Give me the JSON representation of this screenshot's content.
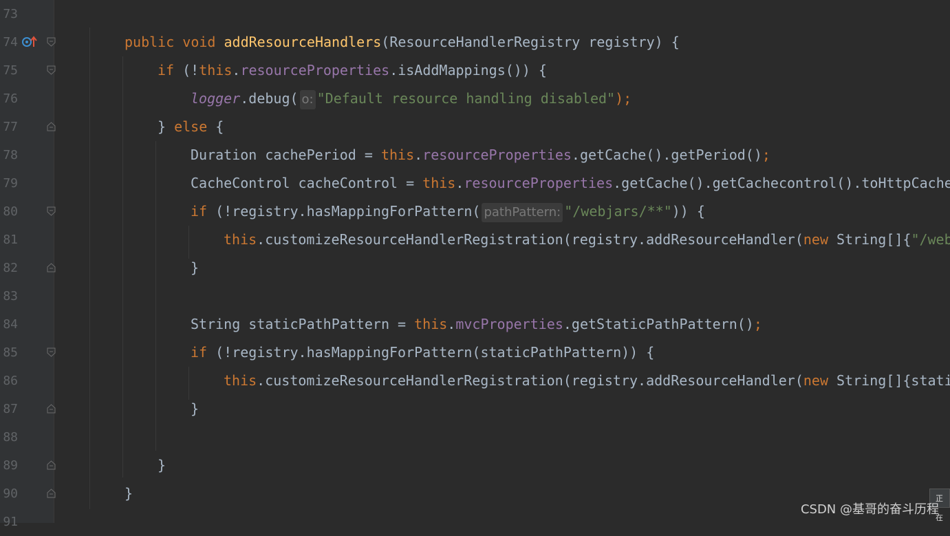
{
  "editor": {
    "lines": [
      {
        "num": "73"
      },
      {
        "num": "74"
      },
      {
        "num": "75"
      },
      {
        "num": "76"
      },
      {
        "num": "77"
      },
      {
        "num": "78"
      },
      {
        "num": "79"
      },
      {
        "num": "80"
      },
      {
        "num": "81"
      },
      {
        "num": "82"
      },
      {
        "num": "83"
      },
      {
        "num": "84"
      },
      {
        "num": "85"
      },
      {
        "num": "86"
      },
      {
        "num": "87"
      },
      {
        "num": "88"
      },
      {
        "num": "89"
      },
      {
        "num": "90"
      },
      {
        "num": "91"
      }
    ],
    "code": {
      "l74": {
        "public": "public",
        "void": "void",
        "method": "addResourceHandlers",
        "params": "(ResourceHandlerRegistry registry) {"
      },
      "l75": {
        "if": "if",
        "open": " (!",
        "this": "this",
        "dot": ".",
        "field": "resourceProperties",
        "rest": ".isAddMappings()) {"
      },
      "l76": {
        "logger": "logger",
        "call": ".debug(",
        "hint": "o:",
        "str": "\"Default resource handling disabled\"",
        "end": ");"
      },
      "l77": {
        "brace": "} ",
        "else": "else",
        "rest": " {"
      },
      "l78": {
        "decl": "Duration cachePeriod = ",
        "this": "this",
        "dot": ".",
        "field": "resourceProperties",
        "rest": ".getCache().getPeriod()",
        "semi": ";"
      },
      "l79": {
        "decl": "CacheControl cacheControl = ",
        "this": "this",
        "dot": ".",
        "field": "resourceProperties",
        "rest": ".getCache().getCachecontrol().toHttpCache"
      },
      "l80": {
        "if": "if",
        "call": " (!registry.hasMappingForPattern(",
        "hint": "pathPattern:",
        "str": "\"/webjars/**\"",
        "end": ")) {"
      },
      "l81": {
        "this": "this",
        "call": ".customizeResourceHandlerRegistration(registry.addResourceHandler(",
        "new": "new",
        "type": " String[]{",
        "str": "\"/web"
      },
      "l82": {
        "brace": "}"
      },
      "l84": {
        "decl": "String staticPathPattern = ",
        "this": "this",
        "dot": ".",
        "field": "mvcProperties",
        "rest": ".getStaticPathPattern()",
        "semi": ";"
      },
      "l85": {
        "if": "if",
        "rest": " (!registry.hasMappingForPattern(staticPathPattern)) {"
      },
      "l86": {
        "this": "this",
        "call": ".customizeResourceHandlerRegistration(registry.addResourceHandler(",
        "new": "new",
        "type": " String[]{stati"
      },
      "l87": {
        "brace": "}"
      },
      "l89": {
        "brace": "}"
      },
      "l90": {
        "brace": "}"
      }
    }
  },
  "watermark": "CSDN @基哥的奋斗历程",
  "toast": "正在",
  "colors": {
    "background": "#2b2b2b",
    "gutter": "#313335",
    "keyword": "#cc7832",
    "method": "#ffc66d",
    "field": "#9876aa",
    "string": "#6a8759",
    "text": "#a9b7c6"
  }
}
